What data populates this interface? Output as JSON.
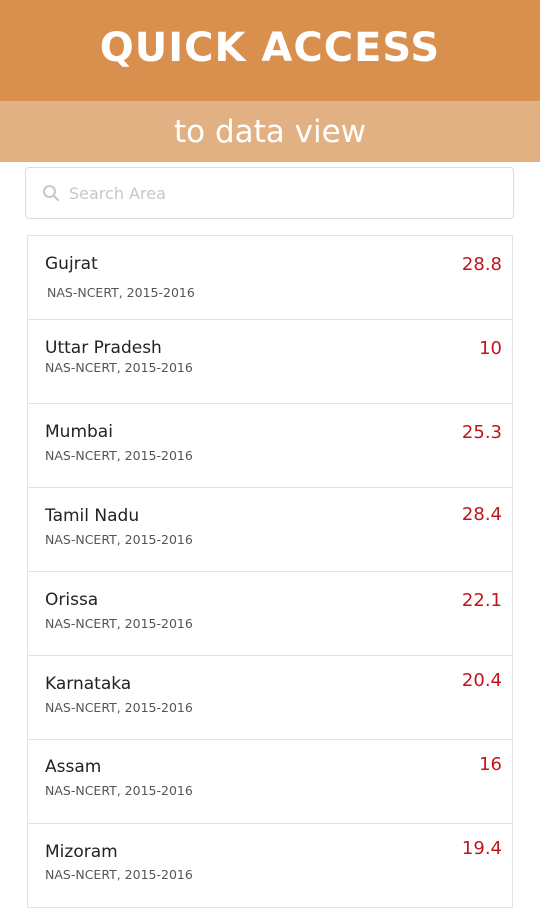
{
  "header": {
    "title": "QUICK ACCESS",
    "subtitle": "to data view"
  },
  "search": {
    "placeholder": "Search Area",
    "value": ""
  },
  "colors": {
    "header_bg": "#d9904e",
    "subheader_bg": "#e2b183",
    "value_red": "#c0161b"
  },
  "areas": [
    {
      "name": "Gujrat",
      "source": "NAS-NCERT, 2015-2016",
      "value": "28.8"
    },
    {
      "name": "Uttar Pradesh",
      "source": "NAS-NCERT, 2015-2016",
      "value": "10"
    },
    {
      "name": "Mumbai",
      "source": "NAS-NCERT, 2015-2016",
      "value": "25.3"
    },
    {
      "name": "Tamil Nadu",
      "source": "NAS-NCERT, 2015-2016",
      "value": "28.4"
    },
    {
      "name": "Orissa",
      "source": "NAS-NCERT, 2015-2016",
      "value": "22.1"
    },
    {
      "name": "Karnataka",
      "source": "NAS-NCERT, 2015-2016",
      "value": "20.4"
    },
    {
      "name": "Assam",
      "source": "NAS-NCERT, 2015-2016",
      "value": "16"
    },
    {
      "name": "Mizoram",
      "source": "NAS-NCERT, 2015-2016",
      "value": "19.4"
    }
  ]
}
